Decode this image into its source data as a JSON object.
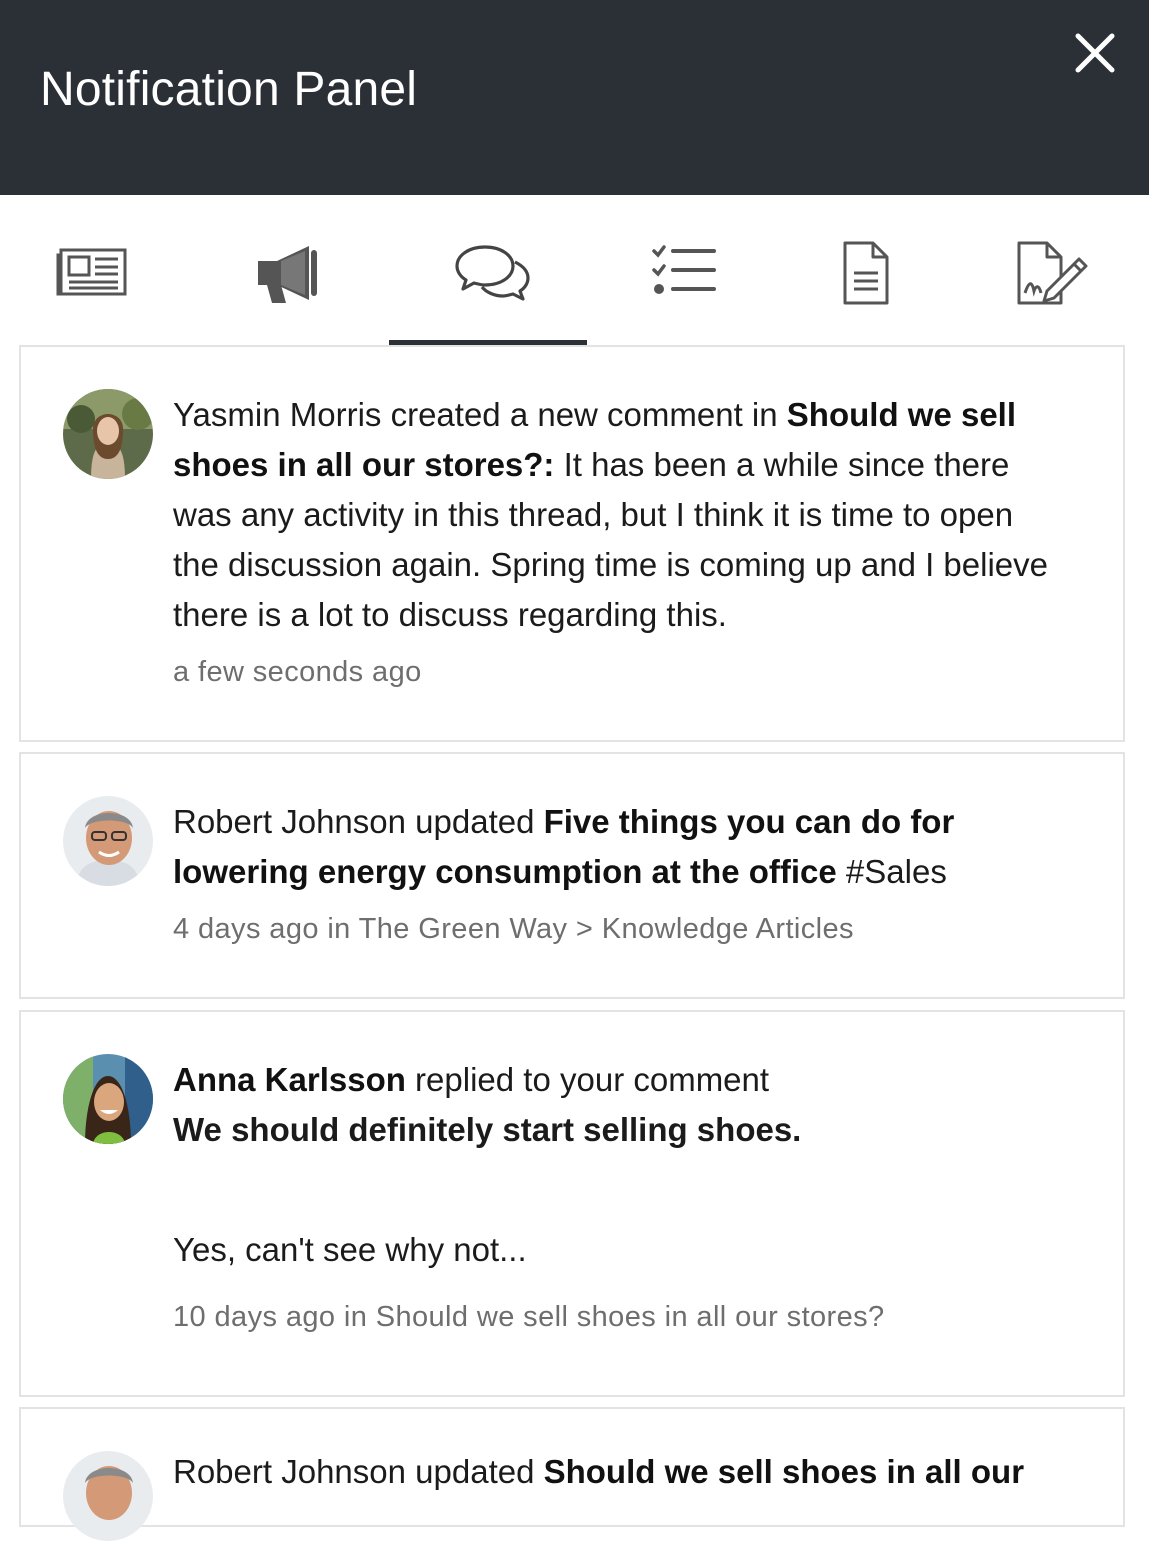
{
  "header": {
    "title": "Notification Panel",
    "close_icon": "close-icon"
  },
  "tabs": [
    {
      "icon": "newspaper-icon",
      "active": false
    },
    {
      "icon": "megaphone-icon",
      "active": false
    },
    {
      "icon": "chat-bubbles-icon",
      "active": true
    },
    {
      "icon": "checklist-icon",
      "active": false
    },
    {
      "icon": "document-icon",
      "active": false
    },
    {
      "icon": "signature-icon",
      "active": false
    }
  ],
  "notifications": [
    {
      "actor": "Yasmin Morris",
      "action": " created a new comment in ",
      "target": "Should we sell shoes in all our stores?:",
      "body": " It has been a while since there was any activity in this thread, but I think it is time to open the discussion again. Spring time is coming up and I believe there is a lot to discuss regarding this.",
      "meta": "a few seconds ago"
    },
    {
      "actor": "Robert Johnson",
      "action": " updated ",
      "target": "Five things you can do for lowering energy consumption at the office",
      "tag": " #Sales",
      "meta": "4 days ago in The Green Way > Knowledge Articles"
    },
    {
      "actor": "Anna Karlsson",
      "action": " replied to your comment",
      "quote": "We should definitely start selling shoes.",
      "reply": "Yes, can't see why not...",
      "meta": "10 days ago in Should we sell shoes in all our stores?"
    },
    {
      "actor": "Robert Johnson",
      "action": " updated ",
      "target": "Should we sell shoes in all our"
    }
  ],
  "colors": {
    "header_bg": "#2b3036",
    "border": "#e3e3e3",
    "meta_text": "#6e6e6e"
  }
}
